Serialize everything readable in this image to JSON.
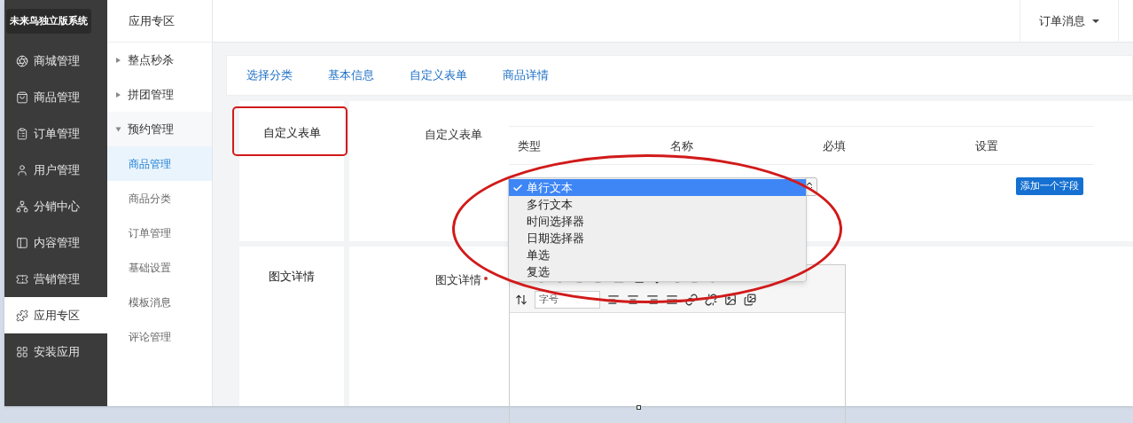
{
  "brand": "未来鸟独立版系统",
  "nav": [
    {
      "label": "商城管理",
      "selected": false
    },
    {
      "label": "商品管理",
      "selected": false
    },
    {
      "label": "订单管理",
      "selected": false
    },
    {
      "label": "用户管理",
      "selected": false
    },
    {
      "label": "分销中心",
      "selected": false
    },
    {
      "label": "内容管理",
      "selected": false
    },
    {
      "label": "营销管理",
      "selected": false
    },
    {
      "label": "应用专区",
      "selected": true
    },
    {
      "label": "安装应用",
      "selected": false
    }
  ],
  "subnav": {
    "title": "应用专区",
    "items": [
      {
        "label": "整点秒杀",
        "kind": "group",
        "expanded": false
      },
      {
        "label": "拼团管理",
        "kind": "group",
        "expanded": false
      },
      {
        "label": "预约管理",
        "kind": "group",
        "expanded": true
      },
      {
        "label": "商品管理",
        "kind": "link",
        "selected": true
      },
      {
        "label": "商品分类",
        "kind": "link",
        "selected": false
      },
      {
        "label": "订单管理",
        "kind": "link",
        "selected": false
      },
      {
        "label": "基础设置",
        "kind": "link",
        "selected": false
      },
      {
        "label": "模板消息",
        "kind": "link",
        "selected": false
      },
      {
        "label": "评论管理",
        "kind": "link",
        "selected": false
      }
    ]
  },
  "header": {
    "menu": "订单消息"
  },
  "tabs": [
    "选择分类",
    "基本信息",
    "自定义表单",
    "商品详情"
  ],
  "custom_form": {
    "section_label": "自定义表单",
    "field_label": "自定义表单",
    "columns": [
      "类型",
      "名称",
      "必填",
      "设置"
    ],
    "type_options": [
      {
        "label": "单行文本",
        "selected": true
      },
      {
        "label": "多行文本",
        "selected": false
      },
      {
        "label": "时间选择器",
        "selected": false
      },
      {
        "label": "日期选择器",
        "selected": false
      },
      {
        "label": "单选",
        "selected": false
      },
      {
        "label": "复选",
        "selected": false
      }
    ],
    "add_button": "添加一个字段"
  },
  "rich_text": {
    "section_label": "图文详情",
    "field_label": "图文详情",
    "required": true,
    "font_size_placeholder": "字号"
  }
}
